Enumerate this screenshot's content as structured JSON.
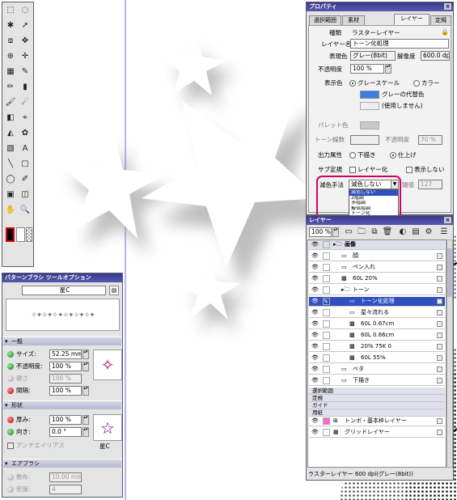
{
  "colors": {
    "titlebar": "#3a3a8c",
    "highlight": "#d00060",
    "selected": "#3050c0"
  },
  "tool_palette": {
    "tools": [
      "selection-rect-icon",
      "lasso-icon",
      "magic-wand-icon",
      "object-select-icon",
      "layer-move-icon",
      "hand-move-icon",
      "zoom-icon",
      "move-icon",
      "ruler-icon",
      "pen-icon",
      "pencil-icon",
      "marker-icon",
      "brush-icon",
      "airbrush-icon",
      "eraser-icon",
      "eyedropper-icon",
      "fill-icon",
      "pattern-brush-icon",
      "gradient-icon",
      "text-icon",
      "line-icon",
      "rect-icon",
      "balloon-icon",
      "correction-icon",
      "stamp-icon",
      "layer-icon",
      "hand-icon",
      "zoom-tool-icon"
    ]
  },
  "pattern_brush": {
    "title": "パターンブラシ ツールオプション",
    "preset": "星C",
    "section_general": "一般",
    "size_label": "サイズ:",
    "size_value": "52.25 mm",
    "opacity_label": "不透明度:",
    "opacity_value": "100 %",
    "hardness_label": "硬さ",
    "hardness_value": "100 %",
    "interval_label": "間隔:",
    "interval_value": "100 %",
    "section_shape": "形状",
    "thickness_label": "厚み:",
    "thickness_value": "100 %",
    "direction_label": "向き:",
    "direction_value": "0.0 °",
    "antialias_label": "アンチエイリアス",
    "shape_caption": "星C",
    "section_airbrush": "エアブラシ",
    "count_label": "数布:",
    "count_value": "10.00 mm",
    "density_label": "密度:",
    "density_value": "4"
  },
  "properties": {
    "title": "プロパティ",
    "tabs": [
      "選択範囲",
      "素材",
      "レイヤー",
      "定規"
    ],
    "type_label": "種類",
    "type_value": "ラスターレイヤー",
    "name_label": "レイヤー名",
    "name_value": "トーン化処理",
    "expression_label": "表現色",
    "expression_value": "グレー(8bit)",
    "resolution_label": "解像度",
    "resolution_value": "600.0 dpi",
    "opacity_label": "不透明度",
    "opacity_value": "100 %",
    "display_label": "表示色",
    "grayscale": "グレースケール",
    "color": "カラー",
    "substitute1": "グレーの代替色",
    "substitute2": "(使用しません)",
    "palette_label": "パレット色",
    "tone_lines_label": "トーン線数",
    "tone_opacity_label": "不透明度",
    "tone_opacity_value": "70 %",
    "output_label": "出力属性",
    "output_draft": "下描き",
    "output_final": "仕上げ",
    "subdef_label": "サブ定規",
    "subdef_layer": "レイヤー化",
    "subdef_hide": "表示しない",
    "reduce_label": "減色手法",
    "reduce_value": "減色しない",
    "threshold_label": "閾値",
    "threshold_value": "127",
    "dropdown": [
      "減色しない",
      "2階調",
      "多階調",
      "擬似階調",
      "トーン化"
    ]
  },
  "layers": {
    "title": "レイヤー",
    "zoom": "100 %",
    "rows": [
      {
        "indent": 0,
        "label": "画像",
        "kind": "group-header"
      },
      {
        "indent": 1,
        "label": "顔",
        "kind": "raster"
      },
      {
        "indent": 1,
        "label": "ペン入れ",
        "kind": "raster"
      },
      {
        "indent": 1,
        "label": "60L 20%",
        "kind": "tone"
      },
      {
        "indent": 1,
        "label": "トーン",
        "kind": "folder"
      },
      {
        "indent": 2,
        "label": "トーン化処理",
        "kind": "selected"
      },
      {
        "indent": 2,
        "label": "星々流れる",
        "kind": "raster"
      },
      {
        "indent": 2,
        "label": "60L 0.67cm",
        "kind": "tone"
      },
      {
        "indent": 2,
        "label": "60L 0.66cm",
        "kind": "tone"
      },
      {
        "indent": 2,
        "label": "20% 75K 0",
        "kind": "tone"
      },
      {
        "indent": 2,
        "label": "60L 55%",
        "kind": "tone"
      },
      {
        "indent": 1,
        "label": "ベタ",
        "kind": "raster"
      },
      {
        "indent": 1,
        "label": "下描き",
        "kind": "raster"
      }
    ],
    "groups": [
      "選択範囲",
      "定規",
      "ガイド",
      "用紙"
    ],
    "paper_rows": [
      "トンボ・基本枠レイヤー",
      "グリッドレイヤー"
    ],
    "status": "ラスターレイヤー 600 dpi(グレー(8bit))"
  }
}
